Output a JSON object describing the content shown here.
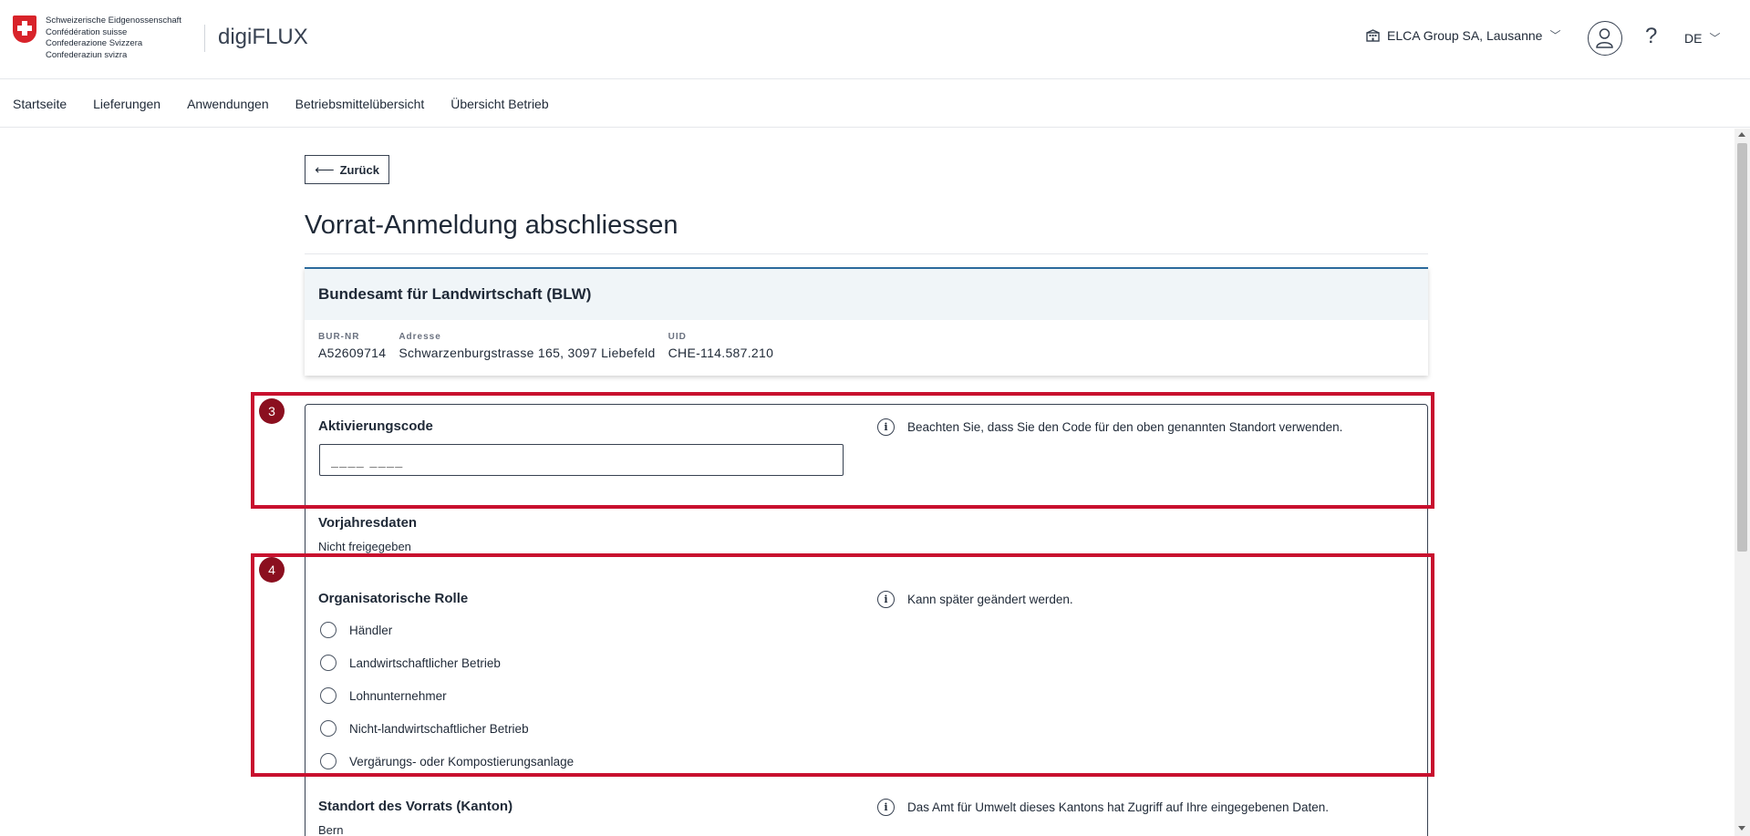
{
  "header": {
    "federation_lines": [
      "Schweizerische Eidgenossenschaft",
      "Confédération suisse",
      "Confederazione Svizzera",
      "Confederaziun svizra"
    ],
    "app_name": "digiFLUX",
    "company": "ELCA Group SA, Lausanne",
    "language": "DE"
  },
  "nav": {
    "items": [
      "Startseite",
      "Lieferungen",
      "Anwendungen",
      "Betriebsmittelübersicht",
      "Übersicht Betrieb"
    ]
  },
  "page": {
    "back_label": "Zurück",
    "title": "Vorrat-Anmeldung abschliessen"
  },
  "card": {
    "name": "Bundesamt für Landwirtschaft (BLW)",
    "fields": [
      {
        "label": "BUR-NR",
        "value": "A52609714"
      },
      {
        "label": "Adresse",
        "value": "Schwarzenburgstrasse 165, 3097 Liebefeld"
      },
      {
        "label": "UID",
        "value": "CHE-114.587.210"
      }
    ]
  },
  "form": {
    "activation": {
      "label": "Aktivierungscode",
      "placeholder": "____ ____",
      "info": "Beachten Sie, dass Sie den Code für den oben genannten Standort verwenden."
    },
    "previous_year": {
      "label": "Vorjahresdaten",
      "value": "Nicht freigegeben"
    },
    "role": {
      "label": "Organisatorische Rolle",
      "info": "Kann später geändert werden.",
      "options": [
        "Händler",
        "Landwirtschaftlicher Betrieb",
        "Lohnunternehmer",
        "Nicht-landwirtschaftlicher Betrieb",
        "Vergärungs- oder Kompostierungsanlage"
      ]
    },
    "location": {
      "label": "Standort des Vorrats (Kanton)",
      "value": "Bern",
      "info": "Das Amt für Umwelt dieses Kantons hat Zugriff auf Ihre eingegebenen Daten."
    }
  },
  "annotations": {
    "badge_3": "3",
    "badge_4": "4",
    "color": "#c8102e"
  }
}
